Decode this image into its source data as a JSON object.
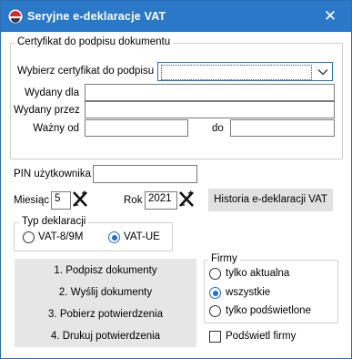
{
  "window": {
    "title": "Seryjne e-deklaracje VAT",
    "close_glyph": "✕"
  },
  "certificate": {
    "legend": "Certyfikat do podpisu dokumentu",
    "select_label": "Wybierz certyfikat do podpisu",
    "selected_value": "",
    "issued_to_label": "Wydany dla",
    "issued_to_value": "",
    "issued_by_label": "Wydany przez",
    "issued_by_value": "",
    "valid_from_label": "Ważny od",
    "valid_from_value": "",
    "valid_to_label": "do",
    "valid_to_value": ""
  },
  "pin": {
    "label": "PIN użytkownika",
    "value": ""
  },
  "period": {
    "month_label": "Miesiąc",
    "month_value": "5",
    "year_label": "Rok",
    "year_value": "2021"
  },
  "history_button": "Historia e-deklaracji VAT",
  "declaration_type": {
    "legend": "Typ deklaracji",
    "options": [
      "VAT-8/9M",
      "VAT-UE"
    ],
    "selected": "VAT-UE"
  },
  "actions": [
    "1. Podpisz dokumenty",
    "2. Wyślij dokumenty",
    "3. Pobierz potwierdzenia",
    "4. Drukuj potwierdzenia"
  ],
  "firms": {
    "legend": "Firmy",
    "options": [
      "tylko aktualna",
      "wszystkie",
      "tylko podświetlone"
    ],
    "selected": "wszystkie"
  },
  "highlight_firms": {
    "label": "Podświetl firmy",
    "checked": false
  },
  "colors": {
    "titlebar": "#2b78c9",
    "accent": "#1e6fd0",
    "button_face": "#e1e1e1"
  }
}
